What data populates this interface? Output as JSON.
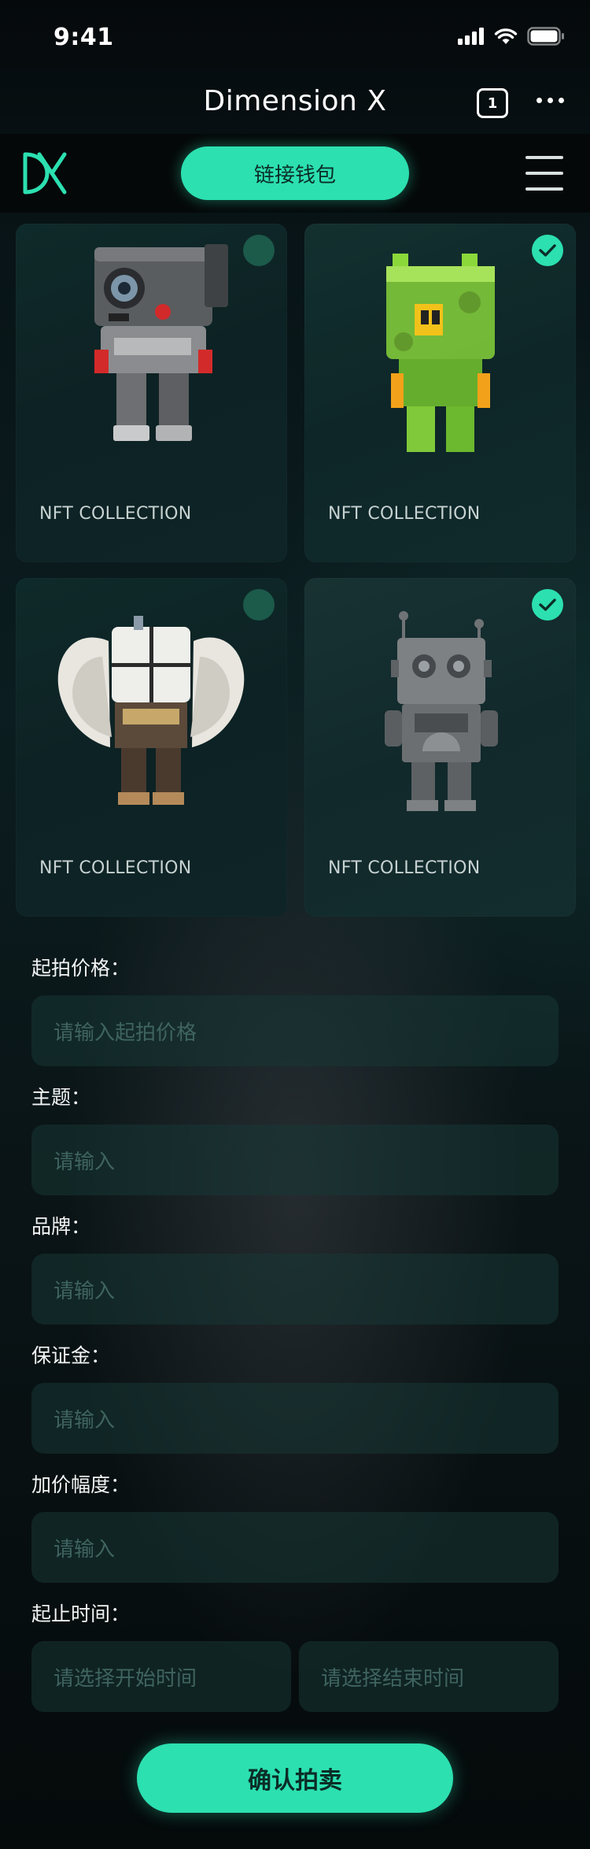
{
  "status_bar": {
    "time": "9:41"
  },
  "nav": {
    "title": "Dimension X",
    "tab_count": "1"
  },
  "header": {
    "connect_label": "链接钱包"
  },
  "cards": [
    {
      "label": "NFT COLLECTION",
      "selected": false,
      "figure": "camera-robot"
    },
    {
      "label": "NFT COLLECTION",
      "selected": true,
      "figure": "green-crystal-robot"
    },
    {
      "label": "NFT COLLECTION",
      "selected": false,
      "figure": "winged-robot"
    },
    {
      "label": "NFT COLLECTION",
      "selected": true,
      "figure": "metal-robot"
    }
  ],
  "form": {
    "price_label": "起拍价格：",
    "price_placeholder": "请输入起拍价格",
    "theme_label": "主题：",
    "theme_placeholder": "请输入",
    "brand_label": "品牌：",
    "brand_placeholder": "请输入",
    "deposit_label": "保证金：",
    "deposit_placeholder": "请输入",
    "increment_label": "加价幅度：",
    "increment_placeholder": "请输入",
    "time_label": "起止时间：",
    "start_placeholder": "请选择开始时间",
    "end_placeholder": "请选择结束时间"
  },
  "submit_label": "确认拍卖",
  "colors": {
    "accent": "#2ce0b0",
    "check_off": "#1c5a4a"
  }
}
